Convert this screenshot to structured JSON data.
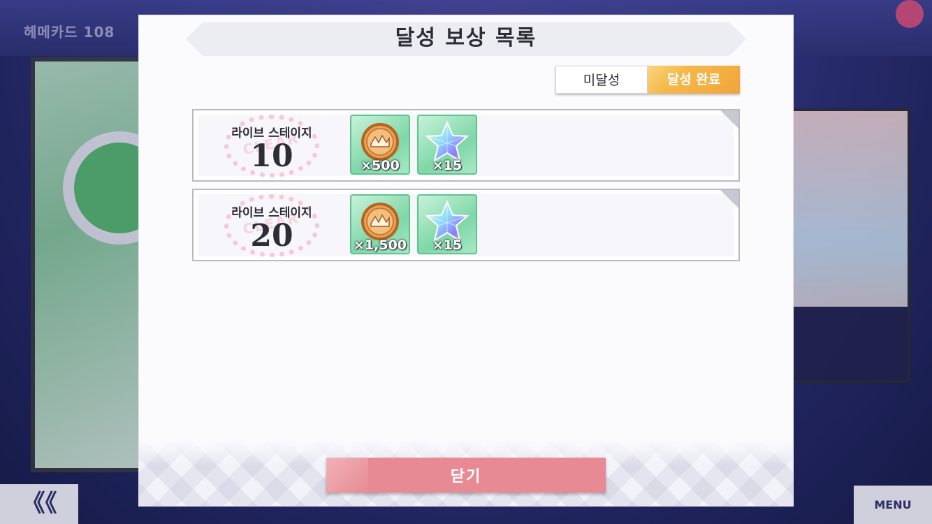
{
  "background": {
    "topbar_text": "헤메카드 108",
    "back_label": "《《",
    "menu_label": "MENU"
  },
  "modal": {
    "title": "달성 보상 목록",
    "tabs": [
      {
        "label": "미달성",
        "active": false
      },
      {
        "label": "달성 완료",
        "active": true
      }
    ],
    "rows": [
      {
        "stage_label": "라이브 스테이지",
        "stage_number": "10",
        "stamp": "CLEAR",
        "rewards": [
          {
            "icon": "coin-icon",
            "quantity": "×500"
          },
          {
            "icon": "star-gem-icon",
            "quantity": "×15"
          }
        ]
      },
      {
        "stage_label": "라이브 스테이지",
        "stage_number": "20",
        "stamp": "CLEAR",
        "rewards": [
          {
            "icon": "coin-icon",
            "quantity": "×1,500"
          },
          {
            "icon": "star-gem-icon",
            "quantity": "×15"
          }
        ]
      }
    ],
    "close_label": "닫기"
  },
  "colors": {
    "accent": "#f5b84a",
    "close_button": "#e88a93",
    "reward_border": "#5cc58a"
  }
}
